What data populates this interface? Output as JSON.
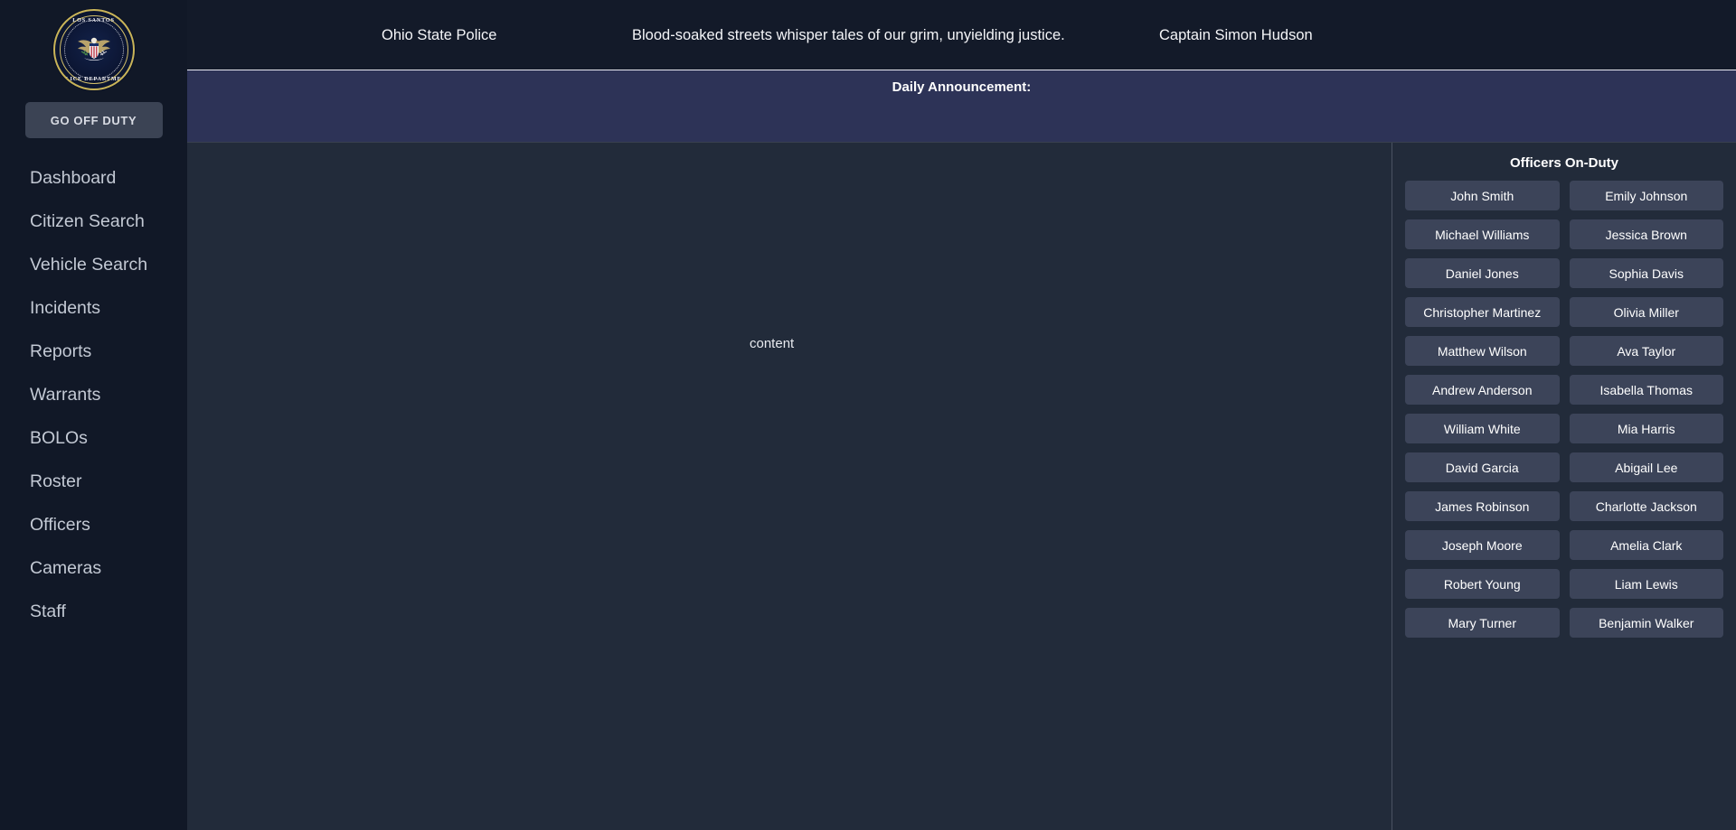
{
  "app": {
    "colors": {
      "sidebar_bg": "#111827",
      "topbar_bg": "#131a29",
      "content_bg": "#222b3a",
      "announcement_bg": "#2d3357",
      "button_bg": "#3c4459",
      "duty_button_bg": "#3b4354",
      "text_primary": "#ffffff",
      "text_muted": "#c3c9d4",
      "seal_gold": "#c9b458"
    }
  },
  "sidebar": {
    "logo": {
      "icon": "police-seal-icon",
      "text_top": "LOS SANTOS",
      "text_bottom": "POLICE DEPARTMENT"
    },
    "duty_button": {
      "label": "GO OFF DUTY"
    },
    "items": [
      {
        "label": "Dashboard",
        "name": "sidebar-item-dashboard"
      },
      {
        "label": "Citizen Search",
        "name": "sidebar-item-citizen-search"
      },
      {
        "label": "Vehicle Search",
        "name": "sidebar-item-vehicle-search"
      },
      {
        "label": "Incidents",
        "name": "sidebar-item-incidents"
      },
      {
        "label": "Reports",
        "name": "sidebar-item-reports"
      },
      {
        "label": "Warrants",
        "name": "sidebar-item-warrants"
      },
      {
        "label": "BOLOs",
        "name": "sidebar-item-bolos"
      },
      {
        "label": "Roster",
        "name": "sidebar-item-roster"
      },
      {
        "label": "Officers",
        "name": "sidebar-item-officers"
      },
      {
        "label": "Cameras",
        "name": "sidebar-item-cameras"
      },
      {
        "label": "Staff",
        "name": "sidebar-item-staff"
      }
    ]
  },
  "header": {
    "department": "Ohio State Police",
    "motto": "Blood-soaked streets whisper tales of our grim, unyielding justice.",
    "user": "Captain Simon Hudson"
  },
  "announcement": {
    "title": "Daily Announcement:",
    "body": ""
  },
  "main": {
    "content_placeholder": "content"
  },
  "officers_panel": {
    "title": "Officers On-Duty",
    "officers": [
      "John Smith",
      "Emily Johnson",
      "Michael Williams",
      "Jessica Brown",
      "Daniel Jones",
      "Sophia Davis",
      "Christopher Martinez",
      "Olivia Miller",
      "Matthew Wilson",
      "Ava Taylor",
      "Andrew Anderson",
      "Isabella Thomas",
      "William White",
      "Mia Harris",
      "David Garcia",
      "Abigail Lee",
      "James Robinson",
      "Charlotte Jackson",
      "Joseph Moore",
      "Amelia Clark",
      "Robert Young",
      "Liam Lewis",
      "Mary Turner",
      "Benjamin Walker"
    ]
  }
}
